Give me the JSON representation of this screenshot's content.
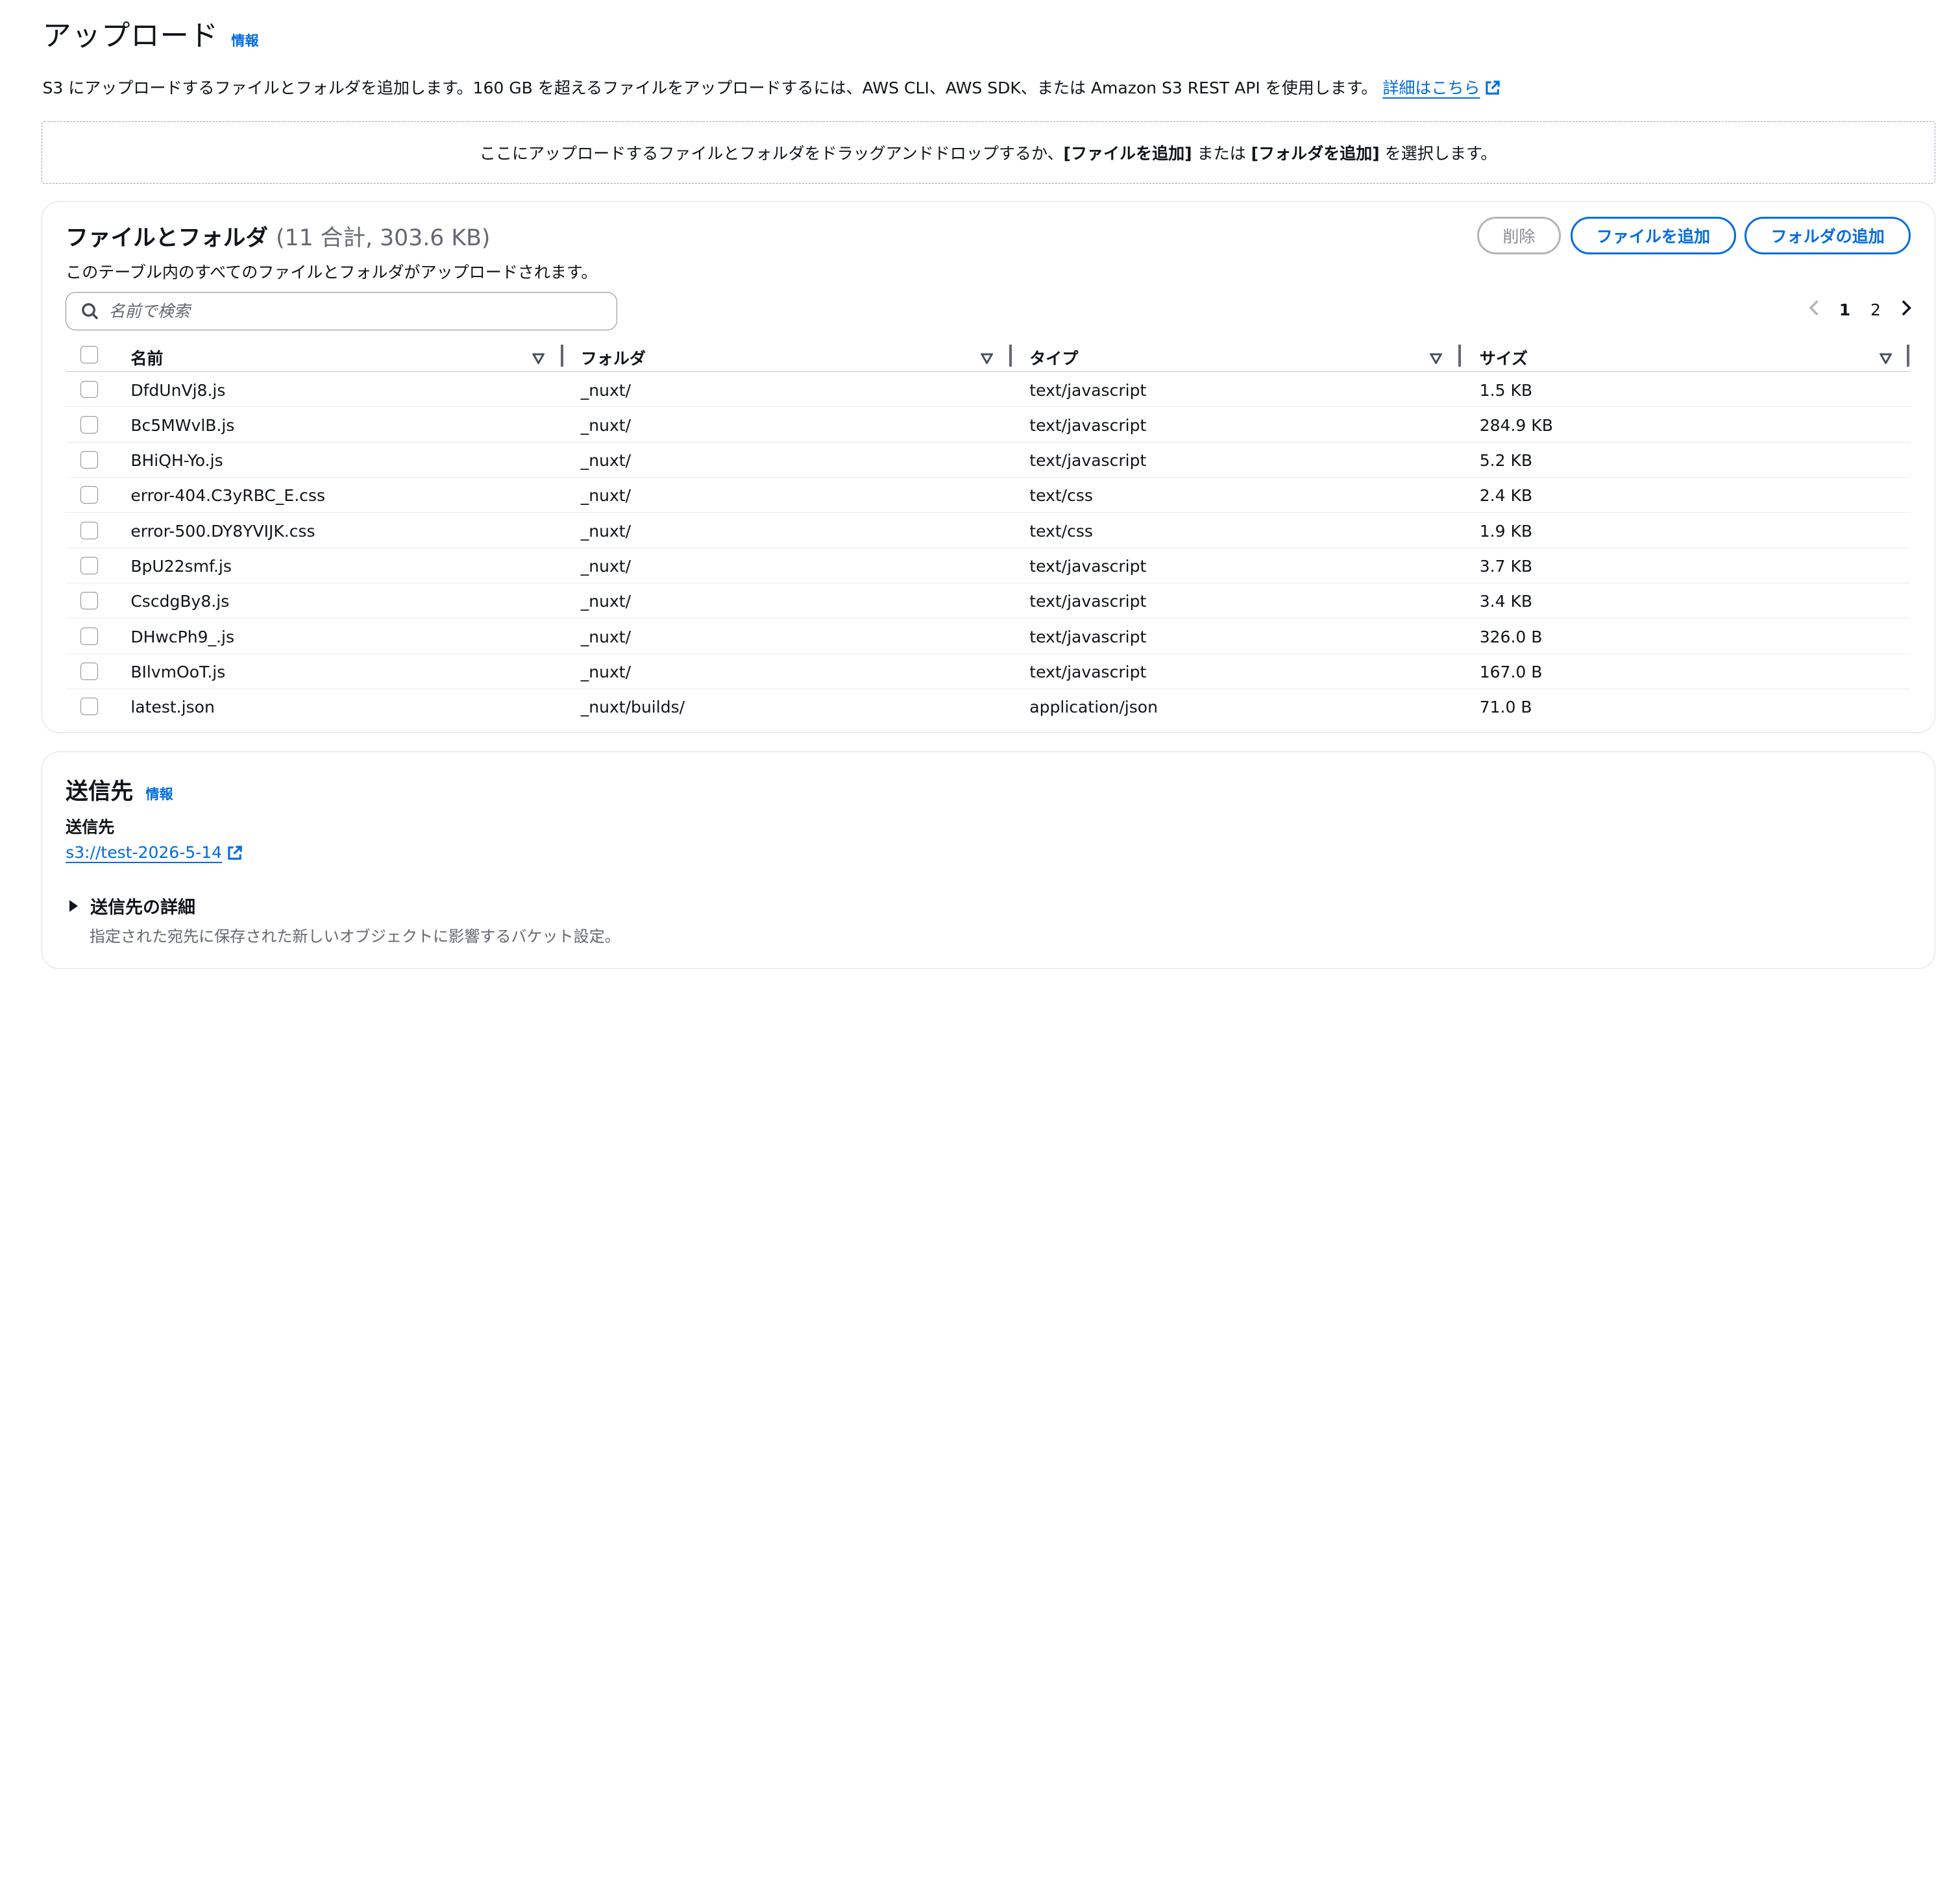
{
  "header": {
    "title": "アップロード",
    "info": "情報",
    "description": "S3 にアップロードするファイルとフォルダを追加します。160 GB を超えるファイルをアップロードするには、AWS CLI、AWS SDK、または Amazon S3 REST API を使用します。",
    "learn_more": "詳細はこちら"
  },
  "dropzone": {
    "text_before": "ここにアップロードするファイルとフォルダをドラッグアンドドロップするか、",
    "add_files": "[ファイルを追加]",
    "or": " または ",
    "add_folder": "[フォルダを追加]",
    "text_after": " を選択します。"
  },
  "files_panel": {
    "title": "ファイルとフォルダ",
    "count": "(11 合計, 303.6 KB)",
    "subtitle": "このテーブル内のすべてのファイルとフォルダがアップロードされます。",
    "delete_button": "削除",
    "add_files_button": "ファイルを追加",
    "add_folder_button": "フォルダの追加",
    "search_placeholder": "名前で検索",
    "pagination": {
      "pages": [
        "1",
        "2"
      ],
      "current": "1"
    },
    "columns": [
      "名前",
      "フォルダ",
      "タイプ",
      "サイズ"
    ],
    "rows": [
      {
        "name": "DfdUnVj8.js",
        "folder": "_nuxt/",
        "type": "text/javascript",
        "size": "1.5 KB"
      },
      {
        "name": "Bc5MWvlB.js",
        "folder": "_nuxt/",
        "type": "text/javascript",
        "size": "284.9 KB"
      },
      {
        "name": "BHiQH-Yo.js",
        "folder": "_nuxt/",
        "type": "text/javascript",
        "size": "5.2 KB"
      },
      {
        "name": "error-404.C3yRBC_E.css",
        "folder": "_nuxt/",
        "type": "text/css",
        "size": "2.4 KB"
      },
      {
        "name": "error-500.DY8YVIJK.css",
        "folder": "_nuxt/",
        "type": "text/css",
        "size": "1.9 KB"
      },
      {
        "name": "BpU22smf.js",
        "folder": "_nuxt/",
        "type": "text/javascript",
        "size": "3.7 KB"
      },
      {
        "name": "CscdgBy8.js",
        "folder": "_nuxt/",
        "type": "text/javascript",
        "size": "3.4 KB"
      },
      {
        "name": "DHwcPh9_.js",
        "folder": "_nuxt/",
        "type": "text/javascript",
        "size": "326.0 B"
      },
      {
        "name": "BIlvmOoT.js",
        "folder": "_nuxt/",
        "type": "text/javascript",
        "size": "167.0 B"
      },
      {
        "name": "latest.json",
        "folder": "_nuxt/builds/",
        "type": "application/json",
        "size": "71.0 B"
      }
    ]
  },
  "destination": {
    "title": "送信先",
    "info": "情報",
    "label": "送信先",
    "link": "s3://test-2026-5-14",
    "details_title": "送信先の詳細",
    "details_sub": "指定された宛先に保存された新しいオブジェクトに影響するバケット設定。"
  },
  "colors": {
    "accent": "#006ce0",
    "text": "#0f141a",
    "muted": "#656871",
    "border": "#dedee3"
  }
}
